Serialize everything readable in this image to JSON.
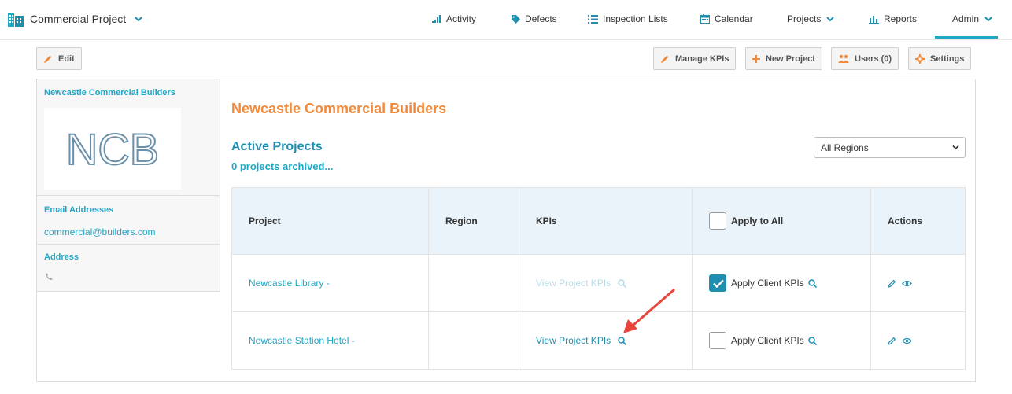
{
  "app": {
    "title": "Commercial Project",
    "nav": [
      {
        "label": "Activity",
        "icon": "bar-chart-icon"
      },
      {
        "label": "Defects",
        "icon": "tag-icon"
      },
      {
        "label": "Inspection Lists",
        "icon": "list-icon"
      },
      {
        "label": "Calendar",
        "icon": "calendar-icon"
      },
      {
        "label": "Projects",
        "icon": "chevron-down-icon"
      },
      {
        "label": "Reports",
        "icon": "column-chart-icon"
      },
      {
        "label": "Admin",
        "icon": "chevron-down-icon"
      }
    ],
    "active_nav": "Admin"
  },
  "toolbar": {
    "edit_label": "Edit",
    "manage_kpis_label": "Manage KPIs",
    "new_project_label": "New Project",
    "users_label": "Users (0)",
    "settings_label": "Settings"
  },
  "client": {
    "name": "Newcastle Commercial Builders",
    "logo_text": "NCB",
    "email_heading": "Email Addresses",
    "email": "commercial@builders.com",
    "address_heading": "Address"
  },
  "main": {
    "title": "Newcastle Commercial Builders",
    "active_projects": "Active Projects",
    "archived": "0 projects archived...",
    "region_filter": "All Regions"
  },
  "table": {
    "headers": {
      "project": "Project",
      "region": "Region",
      "kpis": "KPIs",
      "apply_all": "Apply to All",
      "actions": "Actions"
    },
    "rows": [
      {
        "project": "Newcastle Library -",
        "region": "",
        "kpis": "View Project KPIs",
        "kpis_enabled": false,
        "apply_label": "Apply Client KPIs",
        "apply_checked": true
      },
      {
        "project": "Newcastle Station Hotel -",
        "region": "",
        "kpis": "View Project KPIs",
        "kpis_enabled": true,
        "apply_label": "Apply Client KPIs",
        "apply_checked": false
      }
    ]
  },
  "colors": {
    "accent": "#1fa7c6",
    "title_orange": "#f08a3c",
    "header_bg": "#eaf3fa",
    "arrow_red": "#e8453c"
  }
}
